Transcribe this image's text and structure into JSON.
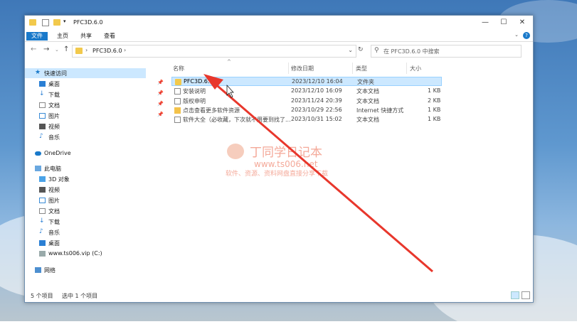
{
  "window": {
    "title": "PFC3D.6.0",
    "controls": [
      "—",
      "☐",
      "✕"
    ]
  },
  "ribbon": {
    "tabs": [
      "文件",
      "主页",
      "共享",
      "查看"
    ],
    "help": "?"
  },
  "addressbar": {
    "path": "PFC3D.6.0",
    "separator": "›",
    "search_placeholder": "在 PFC3D.6.0 中搜索"
  },
  "nav": {
    "quick_access": "快速访问",
    "quick_items": [
      "桌面",
      "下载",
      "文档",
      "图片",
      "视频",
      "音乐"
    ],
    "onedrive": "OneDrive",
    "this_pc": "此电脑",
    "pc_items": [
      "3D 对象",
      "视频",
      "图片",
      "文档",
      "下载",
      "音乐",
      "桌面",
      "www.ts006.vip (C:)"
    ],
    "network": "网络"
  },
  "columns": [
    "名称",
    "修改日期",
    "类型",
    "大小"
  ],
  "files": [
    {
      "name": "PFC3D.6.0",
      "date": "2023/12/10 16:04",
      "type": "文件夹",
      "size": ""
    },
    {
      "name": "安装说明",
      "date": "2023/12/10 16:09",
      "type": "文本文档",
      "size": "1 KB"
    },
    {
      "name": "版权申明",
      "date": "2023/11/24 20:39",
      "type": "文本文档",
      "size": "2 KB"
    },
    {
      "name": "点击查看更多软件资源",
      "date": "2023/10/29 22:56",
      "type": "Internet 快捷方式",
      "size": "1 KB"
    },
    {
      "name": "软件大全（必收藏，下次就不用要到找了...",
      "date": "2023/10/31 15:02",
      "type": "文本文档",
      "size": "1 KB"
    }
  ],
  "status": {
    "count": "5 个项目",
    "selected": "选中 1 个项目"
  },
  "watermark": {
    "title": "丁同学日记本",
    "url": "www.ts006.net",
    "slogan": "软件、资源、资料网盘直接分享下载"
  },
  "colors": {
    "accent": "#1979ca",
    "selection": "#cce8ff",
    "folder": "#f2c94c",
    "annotation_arrow": "#e8372c"
  }
}
